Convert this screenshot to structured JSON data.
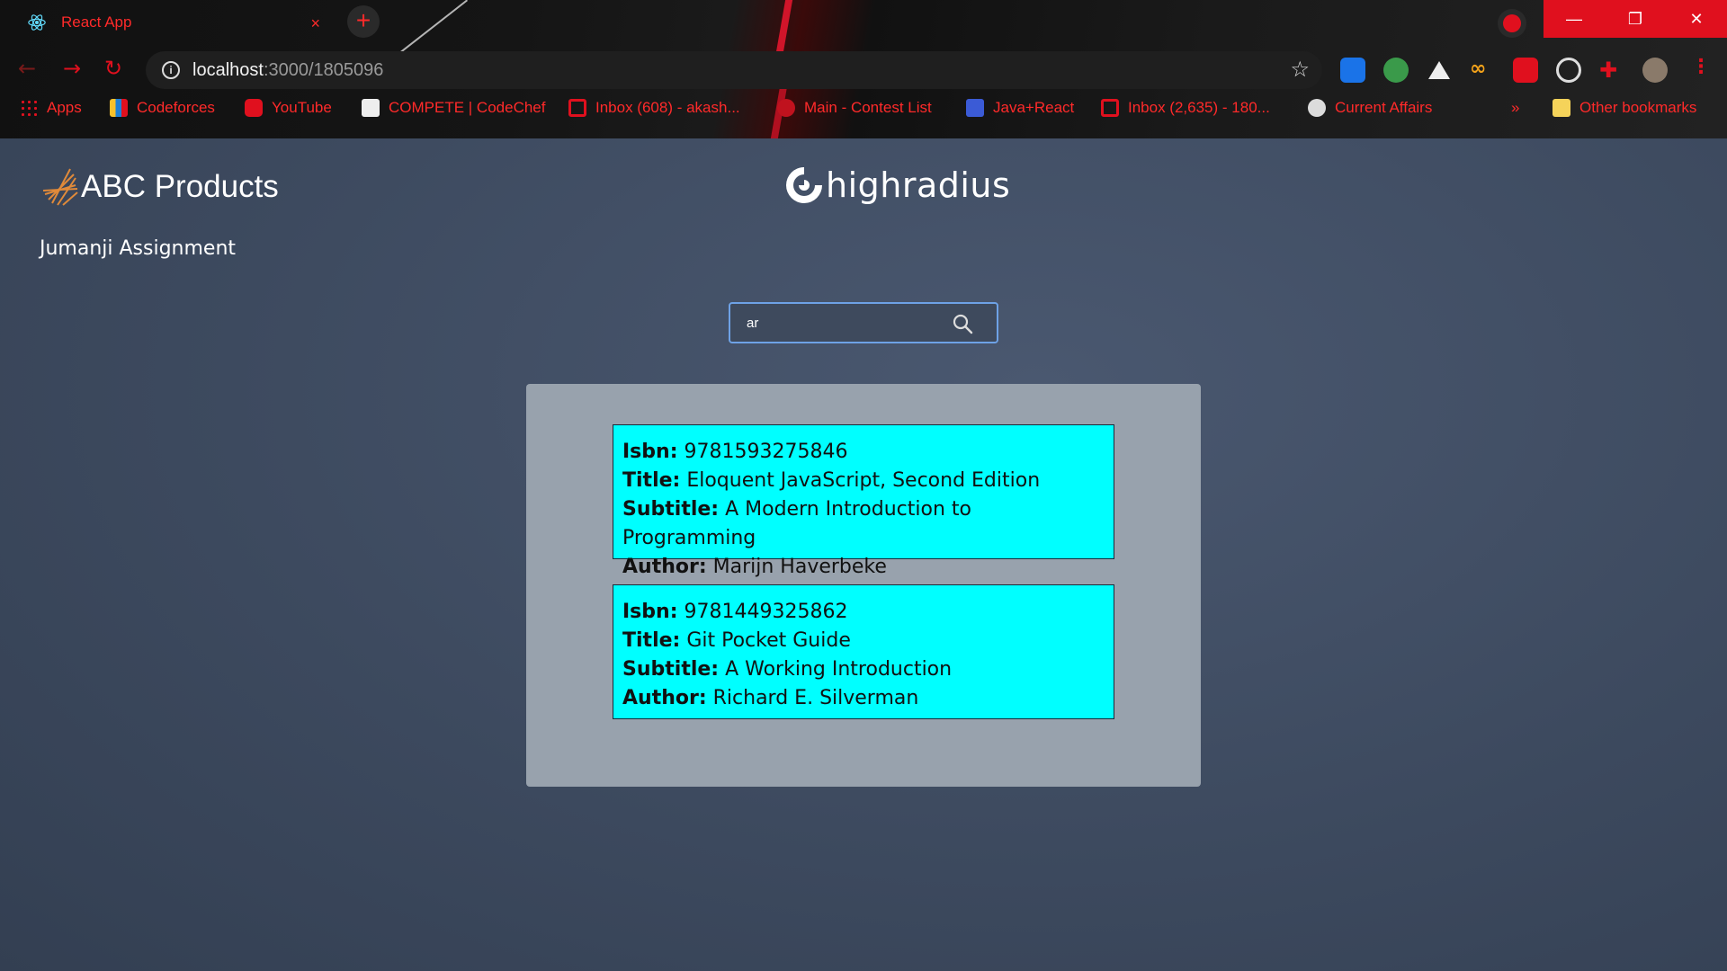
{
  "browser": {
    "tab_title": "React App",
    "tab_close": "×",
    "new_tab": "+",
    "url_host": "localhost",
    "url_path": ":3000/1805096",
    "win_minimize": "—",
    "win_restore": "❐",
    "win_close": "✕",
    "bookmarks": [
      {
        "label": "Apps",
        "color": "#e0101e"
      },
      {
        "label": "Codeforces",
        "color": "#3b7bd6"
      },
      {
        "label": "YouTube",
        "color": "#e0101e"
      },
      {
        "label": "COMPETE | CodeChef",
        "color": "#6b4a2a"
      },
      {
        "label": "Inbox (608) - akash...",
        "color": "#e0101e"
      },
      {
        "label": "Main - Contest List",
        "color": "#e0101e"
      },
      {
        "label": "Java+React",
        "color": "#3b5bd6"
      },
      {
        "label": "Inbox (2,635) - 180...",
        "color": "#e0101e"
      },
      {
        "label": "Current Affairs",
        "color": "#dcdcdc"
      }
    ],
    "bookmarks_overflow": "»",
    "other_bookmarks": "Other bookmarks"
  },
  "header": {
    "brand": "ABC Products",
    "partner": "highradius",
    "subtitle": "Jumanji Assignment"
  },
  "search": {
    "value": "ar",
    "placeholder": ""
  },
  "results": [
    {
      "isbn_label": "Isbn:",
      "isbn": "9781593275846",
      "title_label": "Title:",
      "title": "Eloquent JavaScript, Second Edition",
      "subtitle_label": "Subtitle:",
      "subtitle": "A Modern Introduction to Programming",
      "author_label": "Author:",
      "author": "Marijn Haverbeke"
    },
    {
      "isbn_label": "Isbn:",
      "isbn": "9781449325862",
      "title_label": "Title:",
      "title": "Git Pocket Guide",
      "subtitle_label": "Subtitle:",
      "subtitle": "A Working Introduction",
      "author_label": "Author:",
      "author": "Richard E. Silverman"
    }
  ],
  "colors": {
    "card_bg": "#00ffff",
    "panel_bg": "#98a2ad",
    "page_bg": "#3d4a5f",
    "chrome_accent": "#e0101e"
  }
}
